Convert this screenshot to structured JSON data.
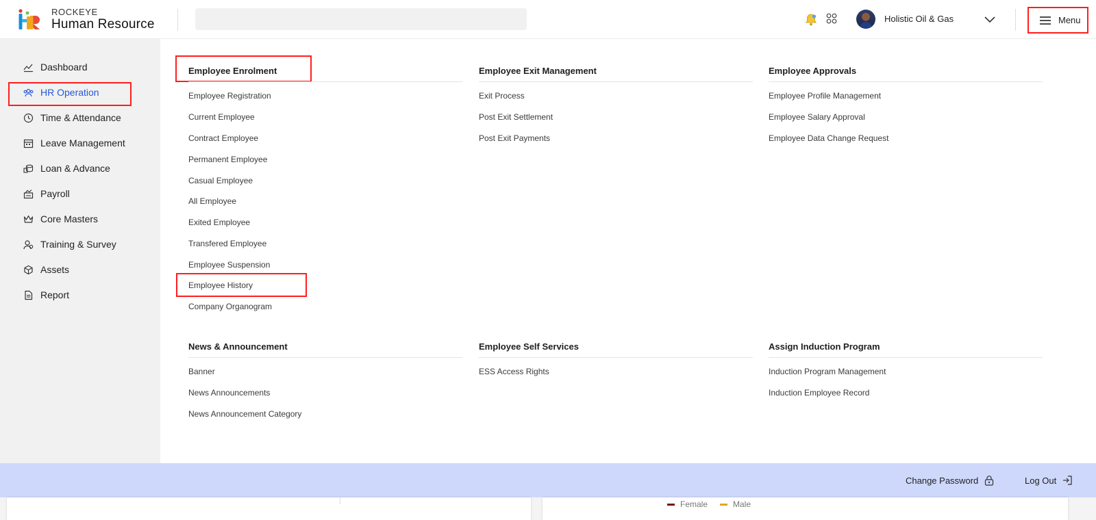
{
  "header": {
    "brand_top": "ROCKEYE",
    "brand_main": "Human Resource",
    "search": {
      "placeholder": "",
      "value": ""
    },
    "company": "Holistic Oil & Gas",
    "menu_label": "Menu",
    "icons": {
      "search": "search-icon",
      "notification": "bell-icon",
      "apps": "grid-icon",
      "dropdown": "chevron-down-icon",
      "menu": "hamburger-icon"
    }
  },
  "sidebar": {
    "items": [
      {
        "label": "Dashboard",
        "icon": "dashboard-icon"
      },
      {
        "label": "HR Operation",
        "icon": "hr-operation-icon",
        "active": true
      },
      {
        "label": "Time & Attendance",
        "icon": "clock-icon"
      },
      {
        "label": "Leave Management",
        "icon": "calendar-icon"
      },
      {
        "label": "Loan & Advance",
        "icon": "coins-icon"
      },
      {
        "label": "Payroll",
        "icon": "payroll-icon"
      },
      {
        "label": "Core Masters",
        "icon": "crown-icon"
      },
      {
        "label": "Training & Survey",
        "icon": "people-icon"
      },
      {
        "label": "Assets",
        "icon": "cube-icon"
      },
      {
        "label": "Report",
        "icon": "document-icon"
      }
    ]
  },
  "menu": {
    "sections": [
      {
        "title": "Employee Enrolment",
        "links": [
          "Employee Registration",
          "Current Employee",
          "Contract Employee",
          "Permanent Employee",
          "Casual Employee",
          "All Employee",
          "Exited Employee",
          "Transfered Employee",
          "Employee Suspension",
          "Employee History",
          "Company Organogram"
        ]
      },
      {
        "title": "Employee Exit Management",
        "links": [
          "Exit Process",
          "Post Exit Settlement",
          "Post Exit Payments"
        ]
      },
      {
        "title": "Employee Approvals",
        "links": [
          "Employee Profile Management",
          "Employee Salary Approval",
          "Employee Data Change Request"
        ]
      },
      {
        "title": "News & Announcement",
        "links": [
          "Banner",
          "News Announcements",
          "News Announcement Category"
        ]
      },
      {
        "title": "Employee Self Services",
        "links": [
          "ESS Access Rights"
        ]
      },
      {
        "title": "Assign Induction Program",
        "links": [
          "Induction Program Management",
          "Induction Employee Record"
        ]
      }
    ]
  },
  "bottom_bar": {
    "change_password": "Change Password",
    "log_out": "Log Out"
  },
  "background_page": {
    "legend": [
      {
        "label": "Female",
        "color": "#7a0b0b"
      },
      {
        "label": "Male",
        "color": "#e0a722"
      }
    ]
  },
  "colors": {
    "accent": "#2458d6",
    "highlight_box": "#ff1d1d",
    "bottom_bar": "#cdd8fb",
    "sidebar_bg": "#f1f1f1"
  }
}
